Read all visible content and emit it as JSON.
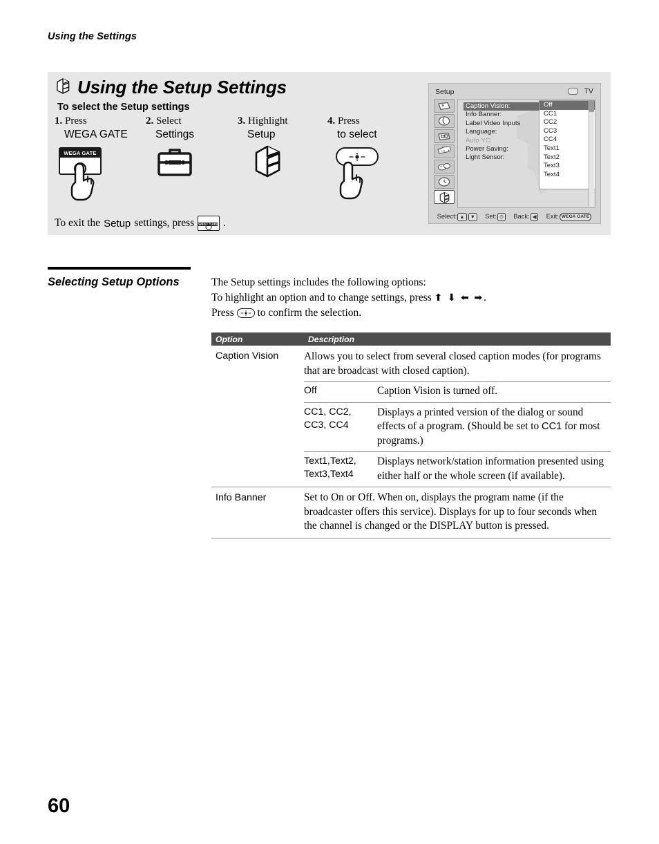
{
  "running_head": "Using the Settings",
  "hero": {
    "title": "Using the Setup Settings",
    "subtitle": "To select the Setup settings",
    "icon": "setup-cube-icon",
    "steps": [
      {
        "num": "1.",
        "verb": "Press",
        "target": "WEGA GATE",
        "art": "wega-gate-button-with-finger"
      },
      {
        "num": "2.",
        "verb": "Select",
        "target": "Settings",
        "art": "toolbox-icon"
      },
      {
        "num": "3.",
        "verb": "Highlight",
        "target": "Setup",
        "art": "setup-cube-icon"
      },
      {
        "num": "4.",
        "verb": "Press",
        "target": "to select",
        "art": "center-button-with-finger"
      }
    ],
    "exit_note": {
      "before": "To exit the ",
      "emphasis": "Setup",
      "after": " settings, press ",
      "button_label": "WEGA GATE",
      "end": "."
    }
  },
  "osd": {
    "title": "Setup",
    "source_label": "TV",
    "sidebar_icons": [
      "picture-icon",
      "audio-icon",
      "screen-icon",
      "channel-icon",
      "parental-icon",
      "timer-icon",
      "setup-icon"
    ],
    "active_icon_index": 6,
    "menu_items": [
      {
        "label": "Caption Vision:",
        "state": "selected"
      },
      {
        "label": "Info Banner:",
        "state": "normal"
      },
      {
        "label": "Label Video Inputs",
        "state": "normal"
      },
      {
        "label": "Language:",
        "state": "normal"
      },
      {
        "label": "Auto YC:",
        "state": "dimmed"
      },
      {
        "label": "Power Saving:",
        "state": "normal"
      },
      {
        "label": "Light Sensor:",
        "state": "normal"
      }
    ],
    "values": [
      {
        "label": "Off",
        "state": "selected"
      },
      {
        "label": "CC1",
        "state": "normal"
      },
      {
        "label": "CC2",
        "state": "normal"
      },
      {
        "label": "CC3",
        "state": "normal"
      },
      {
        "label": "CC4",
        "state": "normal"
      },
      {
        "label": "Text1",
        "state": "normal"
      },
      {
        "label": "Text2",
        "state": "normal"
      },
      {
        "label": "Text3",
        "state": "normal"
      },
      {
        "label": "Text4",
        "state": "normal"
      }
    ],
    "footer": {
      "select_label": "Select:",
      "set_label": "Set:",
      "back_label": "Back:",
      "exit_label": "Exit:",
      "exit_key": "WEGA GATE"
    }
  },
  "section": {
    "heading": "Selecting Setup Options",
    "intro_line1": "The Setup settings includes the following options:",
    "intro_line2_a": "To highlight an option and to change settings, press ",
    "intro_line2_arrows": "⬆ ⬇ ⬅ ➡",
    "intro_line2_b": ".",
    "intro_line3_a": "Press ",
    "intro_line3_b": " to confirm the selection."
  },
  "table": {
    "headers": {
      "option": "Option",
      "description": "Description"
    },
    "rows": [
      {
        "option": "Caption Vision",
        "description": "Allows you to select from several closed caption modes (for programs that are broadcast with closed caption).",
        "sub_rows": [
          {
            "option": "Off",
            "description": "Caption Vision is turned off."
          },
          {
            "option": "CC1, CC2, CC3, CC4",
            "description_1": "Displays a printed version of the dialog or sound effects of a program. (Should be set to ",
            "description_em": "CC1",
            "description_2": " for most programs.)"
          },
          {
            "option": "Text1,Text2, Text3,Text4",
            "description": "Displays network/station information presented using either half or the whole screen (if available)."
          }
        ]
      },
      {
        "option": "Info Banner",
        "description_1": "Set to ",
        "description_em1": "On",
        "description_2": " or ",
        "description_em2": "Off",
        "description_3": ". When on, displays the program name (if the broadcaster offers this service). Displays for up to four seconds when the channel is changed or the ",
        "description_em3": "DISPLAY",
        "description_4": " button is pressed."
      }
    ]
  },
  "page_number": "60",
  "colors": {
    "panel_bg": "#e7e7e7",
    "table_header_bg": "#4d4d4d",
    "osd_bg": "#d4d4d4",
    "osd_highlight": "#6d6d6d"
  }
}
